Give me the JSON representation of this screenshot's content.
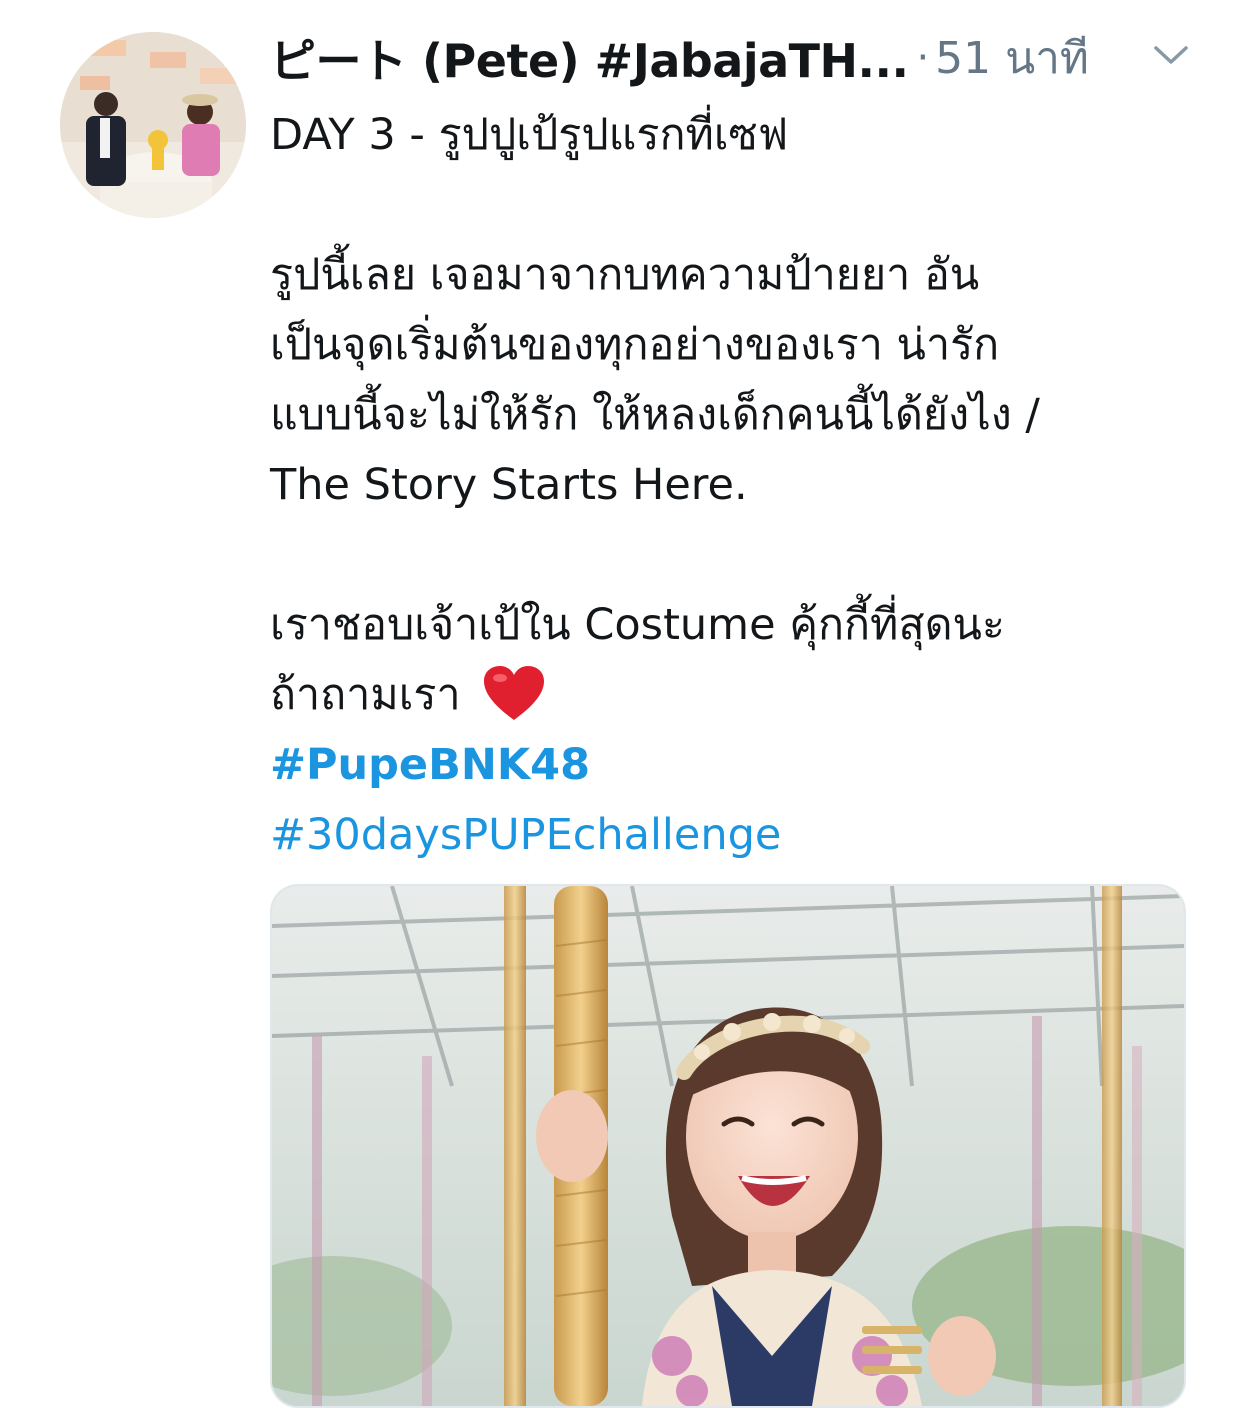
{
  "tweet": {
    "author": {
      "display_name": "ピート (Pete) #JabajaTH...",
      "avatar_icon": "profile-photo"
    },
    "separator": "·",
    "timestamp": "51 นาที",
    "menu_icon": "chevron-down-icon",
    "text_lines": [
      "DAY 3 - รูปปูเป้รูปแรกที่เซฟ",
      "",
      "รูปนี้เลย เจอมาจากบทความป้ายยา อัน",
      "เป็นจุดเริ่มต้นของทุกอย่างของเรา น่ารัก",
      "แบบนี้จะไม่ให้รัก ให้หลงเด็กคนนี้ได้ยังไง /",
      "The Story Starts Here.",
      "",
      "เราชอบเจ้าเป้ใน Costume คุ้กกี้ที่สุดนะ",
      "ถ้าถามเรา"
    ],
    "emoji": "heart-icon",
    "hashtags": [
      "#PupeBNK48",
      "#30daysPUPEchallenge"
    ],
    "media": {
      "type": "photo"
    }
  },
  "colors": {
    "text": "#14171a",
    "secondary": "#657786",
    "link": "#1b95e0",
    "heart": "#e0202e",
    "border": "#e1e8ed"
  }
}
